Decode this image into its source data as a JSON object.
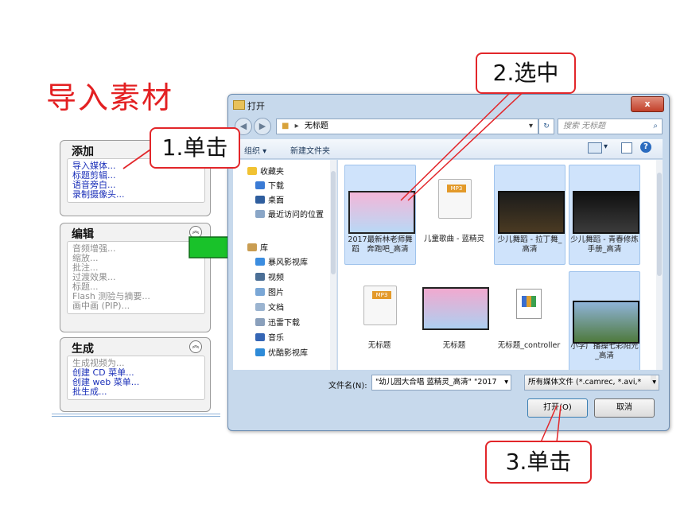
{
  "slide": {
    "title": "导入素材"
  },
  "panels": {
    "add": {
      "title": "添加",
      "items": [
        "导入媒体...",
        "标题剪辑...",
        "语音旁白...",
        "录制摄像头..."
      ]
    },
    "edit": {
      "title": "编辑",
      "items": [
        "音频增强...",
        "缩放...",
        "批注...",
        "过渡效果...",
        "标题...",
        "Flash 测验与摘要...",
        "画中画 (PIP)..."
      ]
    },
    "produce": {
      "title": "生成",
      "items": [
        "生成视频为...",
        "创建 CD 菜单...",
        "创建 web 菜单...",
        "批生成..."
      ]
    }
  },
  "dialog": {
    "title": "打开",
    "close": "x",
    "path": "无标题",
    "search_placeholder": "搜索 无标题",
    "toolbar": {
      "organize": "组织 ▾",
      "new_folder": "新建文件夹"
    },
    "nav": {
      "favorites": "收藏夹",
      "favorites_items": [
        "下载",
        "桌面",
        "最近访问的位置"
      ],
      "library": "库",
      "library_items": [
        "暴风影视库",
        "视频",
        "图片",
        "文档",
        "迅雷下载",
        "音乐",
        "优酷影视库"
      ]
    },
    "files": [
      {
        "name": "2017最新林老师舞蹈　奔跑吧_高清",
        "selected": true,
        "kind": "video"
      },
      {
        "name": "儿童歌曲 - 蓝精灵",
        "selected": false,
        "kind": "mp3"
      },
      {
        "name": "少儿舞蹈 - 拉丁舞_高清",
        "selected": true,
        "kind": "video"
      },
      {
        "name": "少儿舞蹈 - 青春修炼手册_高清",
        "selected": true,
        "kind": "video"
      },
      {
        "name": "无标题",
        "selected": false,
        "kind": "mp3"
      },
      {
        "name": "无标题",
        "selected": false,
        "kind": "video"
      },
      {
        "name": "无标题_controller",
        "selected": false,
        "kind": "doc"
      },
      {
        "name": "小学广播操七彩阳光_高清",
        "selected": true,
        "kind": "video"
      }
    ],
    "filename_label": "文件名(N):",
    "filename_value": "\"幼儿园大合唱 蓝精灵_高清\" \"2017",
    "filetype_value": "所有媒体文件 (*.camrec, *.avi,*",
    "open_button": "打开(O)",
    "cancel_button": "取消"
  },
  "callouts": {
    "step1": "1.单击",
    "step2": "2.选中",
    "step3": "3.单击"
  }
}
